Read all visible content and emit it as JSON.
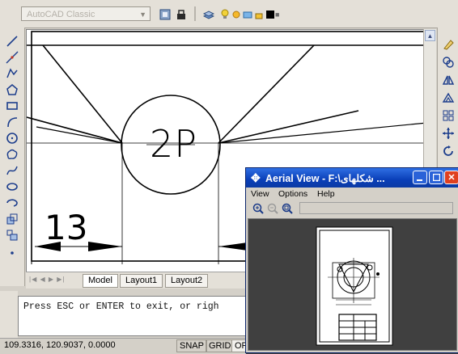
{
  "toolbar": {
    "workspace_combo": "AutoCAD Classic",
    "icons": [
      "layers-icon",
      "layer-states-icon",
      "match-icon",
      "lightbulb-icon",
      "sun-icon",
      "freeze-icon",
      "lock-icon",
      "color-swatch-icon"
    ]
  },
  "drawing": {
    "balloon_label": "2P",
    "dimension_value": "13"
  },
  "tabs": [
    "Model",
    "Layout1",
    "Layout2"
  ],
  "command": {
    "line1": "Press ESC or ENTER to exit, or righ"
  },
  "status": {
    "coordinates": "109.3316, 120.9037, 0.0000",
    "snap": "SNAP",
    "grid": "GRID",
    "ortho": "ORTHO"
  },
  "aerial_view": {
    "title": "Aerial View - F:\\شكلهای ...",
    "menu": [
      "View",
      "Options",
      "Help"
    ]
  },
  "colors": {
    "title_blue": "#0a3fb8",
    "close_red": "#e04020",
    "panel": "#d4d0c8"
  }
}
